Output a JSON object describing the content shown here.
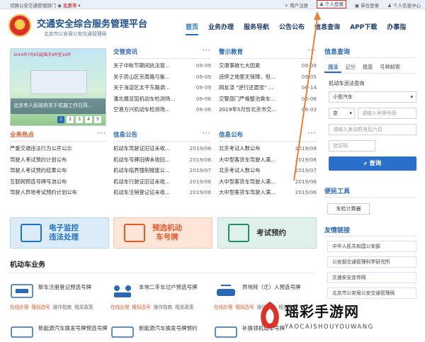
{
  "topbar": {
    "prefix": "切换公安交通管理部门",
    "region": "北京市",
    "links": [
      "用户注册",
      "个人登录",
      "单位登录",
      "个人信息中心"
    ]
  },
  "header": {
    "title": "交通安全综合服务管理平台",
    "subtitle": "北京市公安局公安交通管理局",
    "nav": [
      "首页",
      "业务办理",
      "服务导航",
      "公告公布",
      "信息查询",
      "APP下载",
      "办事指"
    ]
  },
  "banner": {
    "caption": "北京市人民政府关于实施工作日高...",
    "strip": "2019年7月8日起每天9时至16时",
    "pages": [
      "1",
      "2",
      "3",
      "4",
      "5"
    ]
  },
  "traffic_news": {
    "title": "交管资讯",
    "more": "···",
    "items": [
      {
        "t": "关于中秋节期间执法窗...",
        "d": "09-09"
      },
      {
        "t": "关于房山区京周路与紫...",
        "d": "09-09"
      },
      {
        "t": "关于海淀区太平东路调...",
        "d": "09-09"
      },
      {
        "t": "潘北展览馆机动车检测场...",
        "d": "09-06"
      },
      {
        "t": "空港方兴机动车检测场...",
        "d": "09-06"
      }
    ]
  },
  "warning_edu": {
    "title": "警示教育",
    "more": "···",
    "items": [
      {
        "t": "交通事故七大因素",
        "d": "09-09"
      },
      {
        "t": "违停之地里无保障，但...",
        "d": "09-05"
      },
      {
        "t": "网友浇 \"逆行还嚣张\" ...",
        "d": "06-14"
      },
      {
        "t": "交警部门严格整治乘车...",
        "d": "06-06"
      },
      {
        "t": "2019年5月份北京市交...",
        "d": "06-03"
      }
    ]
  },
  "hot_business": {
    "title": "业务热点",
    "more": "···",
    "items": [
      "严重交通违法行为公开公示",
      "驾驶人考试预约计划公布",
      "驾驶人考试预约结果公布",
      "互联网预选号牌号池公布",
      "驾驶人异地考试预约计划公布"
    ]
  },
  "info_notice": {
    "title": "信息公告",
    "more": "···",
    "items": [
      {
        "t": "机动车驾驶证旧证未收...",
        "d": "2019/08"
      },
      {
        "t": "机动车号牌旧牌未收回...",
        "d": "2019/08"
      },
      {
        "t": "机动车临界强制报废公...",
        "d": "2019/07"
      },
      {
        "t": "机动车行驶证旧证未收...",
        "d": "2019/08"
      },
      {
        "t": "机动车注销登记证未收...",
        "d": "2019/08"
      }
    ]
  },
  "info_publish": {
    "title": "信息公布",
    "more": "···",
    "items": [
      {
        "t": "北京考试人数公布",
        "d": "2019/08"
      },
      {
        "t": "大中型客货车驾驶人满...",
        "d": "2019/08"
      },
      {
        "t": "北京考试人数公布",
        "d": "2019/07"
      },
      {
        "t": "大中型客货车驾驶人满...",
        "d": "2019/08"
      },
      {
        "t": "大中型客货车驾驶人满...",
        "d": "2019/06"
      }
    ]
  },
  "tiles": [
    {
      "label": "电子监控\n违法处理"
    },
    {
      "label": "预选机动\n车号牌"
    },
    {
      "label": "考试预约"
    }
  ],
  "motor": {
    "title": "机动车业务",
    "services": [
      {
        "name": "新车注册登记预选号牌",
        "actions": [
          "在线办理",
          "模拟选号",
          "操作指南",
          "相关政策"
        ]
      },
      {
        "name": "本地二手车过户预选号牌",
        "actions": [
          "在线办理",
          "模拟选号",
          "操作指南",
          "相关政策"
        ]
      },
      {
        "name": "异地转（迁）入预选号牌",
        "actions": [
          "在线办理",
          "模拟选号",
          "操作指南",
          "相关政策"
        ]
      },
      {
        "name": "新能源汽车换发号牌预选号牌",
        "actions": []
      },
      {
        "name": "新能源汽车换发号牌预约",
        "actions": []
      },
      {
        "name": "补换领机动车号牌",
        "actions": []
      }
    ]
  },
  "query": {
    "title": "信息查询",
    "tabs": [
      "违法",
      "记分",
      "报废",
      "号牌邮寄"
    ],
    "subtitle": "机动车违法查询",
    "vehicle_type": "小型汽车",
    "province": "京",
    "plate_placeholder": "请输入号牌号码",
    "engine_placeholder": "请输入发动机号后六位",
    "captcha_placeholder": "验证码",
    "button": "查询"
  },
  "tools": {
    "title": "便民工具",
    "items": [
      "车检计算器"
    ]
  },
  "links": {
    "title": "友情链接",
    "items": [
      "中华人民共和国公安部",
      "公安部交通管理科学研究所",
      "交通安全宣传网",
      "北京市公安局公安交通管理局"
    ]
  },
  "watermark": {
    "text": "瑶彩手游网",
    "sub": "YAOCAISHOUYOUWANG"
  },
  "colors": {
    "primary": "#2b69b5",
    "accent_red": "#d9342b",
    "orange": "#e25a2a",
    "tile_blue_bg": "#dcebf8",
    "tile_orange_bg": "#fde6d8",
    "tile_green_bg": "#dff1ea"
  }
}
